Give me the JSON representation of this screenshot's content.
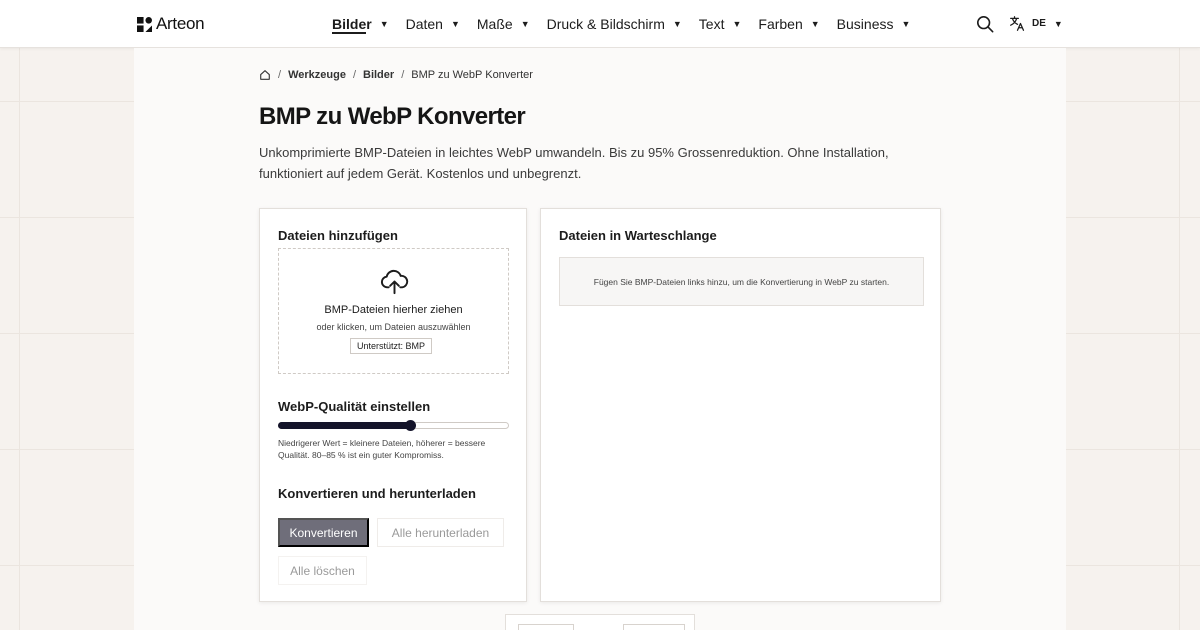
{
  "brand": {
    "name": "Arteon",
    "icon": "arteon-logo-icon"
  },
  "nav": {
    "items": [
      {
        "label": "Bilder",
        "active": true
      },
      {
        "label": "Daten",
        "active": false
      },
      {
        "label": "Maße",
        "active": false
      },
      {
        "label": "Druck & Bildschirm",
        "active": false
      },
      {
        "label": "Text",
        "active": false
      },
      {
        "label": "Farben",
        "active": false
      },
      {
        "label": "Business",
        "active": false
      }
    ],
    "caret": "▼",
    "search_icon": "search-icon",
    "language": {
      "code": "DE",
      "icon": "translate-icon"
    }
  },
  "breadcrumb": {
    "home_icon": "home-icon",
    "separator": "/",
    "items": [
      "Werkzeuge",
      "Bilder",
      "BMP zu WebP Konverter"
    ]
  },
  "page": {
    "title": "BMP zu WebP Konverter",
    "intro": "Unkomprimierte BMP-Dateien in leichtes WebP umwandeln. Bis zu 95% Grossenreduktion. Ohne Installation, funktioniert auf jedem Gerät. Kostenlos und unbegrenzt."
  },
  "upload": {
    "heading": "Dateien hinzufügen",
    "icon": "cloud-upload-icon",
    "drop_title": "BMP-Dateien hierher ziehen",
    "drop_subtitle": "oder klicken, um Dateien auszuwählen",
    "supported": "Unterstützt: BMP"
  },
  "quality": {
    "heading": "WebP-Qualität einstellen",
    "value_fraction": 0.57,
    "hint": "Niedrigerer Wert = kleinere Dateien, höherer = bessere Qualität. 80–85 % ist ein guter Kompromiss."
  },
  "actions": {
    "heading": "Konvertieren und herunterladen",
    "convert": "Konvertieren",
    "download_all": "Alle herunterladen",
    "clear_all": "Alle löschen"
  },
  "queue": {
    "heading": "Dateien in Warteschlange",
    "empty_message": "Fügen Sie BMP-Dateien links hinzu, um die Konvertierung in WebP zu starten."
  },
  "colors": {
    "accent": "#14142a",
    "primary_button": "#6f6e7a",
    "page_background": "#f6f2ee"
  }
}
